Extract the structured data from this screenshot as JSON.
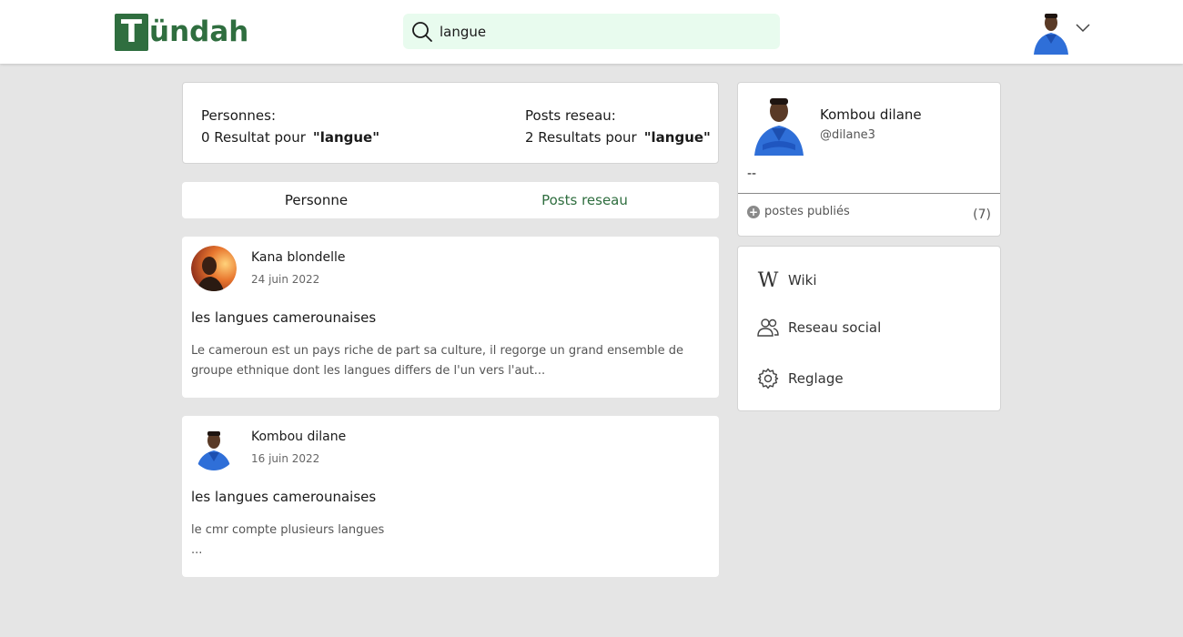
{
  "header": {
    "logo_letter": "T",
    "logo_rest": "ündah",
    "search_value": "langue"
  },
  "results": {
    "people_label": "Personnes:",
    "people_count": "0 Resultat pour",
    "people_query": "\"langue\"",
    "posts_label": "Posts reseau:",
    "posts_count": "2 Resultats pour",
    "posts_query": "\"langue\""
  },
  "tabs": [
    {
      "label": "Personne"
    },
    {
      "label": "Posts reseau"
    }
  ],
  "posts": [
    {
      "author": "Kana blondelle",
      "date": "24 juin 2022",
      "title": "les langues camerounaises",
      "excerpt": "Le cameroun est un pays riche de part sa culture, il regorge un grand ensemble de groupe ethnique dont les langues differs de l'un vers l'aut..."
    },
    {
      "author": "Kombou dilane",
      "date": "16 juin 2022",
      "title": "les langues camerounaises",
      "excerpt_line1": "le cmr compte plusieurs langues",
      "excerpt_line2": "..."
    }
  ],
  "profile": {
    "name": "Kombou dilane",
    "handle": "@dilane3",
    "bio": "--",
    "stat_label": "postes publiés",
    "stat_count": "(7)"
  },
  "menu": [
    {
      "label": "Wiki",
      "icon": "wiki-w-icon"
    },
    {
      "label": "Reseau social",
      "icon": "users-icon"
    },
    {
      "label": "Reglage",
      "icon": "gear-icon"
    }
  ],
  "colors": {
    "brand_green": "#2f6e3f",
    "search_bg": "#e8fbee",
    "page_bg": "#e5e5e5"
  }
}
